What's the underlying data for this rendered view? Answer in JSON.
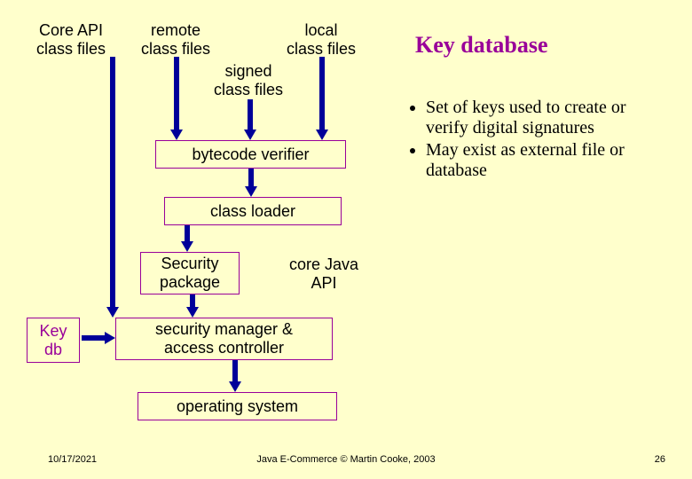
{
  "labels": {
    "core_api": "Core API\nclass files",
    "remote": "remote\nclass files",
    "local": "local\nclass files",
    "signed": "signed\nclass files",
    "key_db_left": "Key\ndb"
  },
  "boxes": {
    "bytecode_verifier": "bytecode verifier",
    "class_loader": "class loader",
    "security_package": "Security\npackage",
    "core_java_api": "core Java\nAPI",
    "sec_mgr": "security manager &\naccess controller",
    "os": "operating system"
  },
  "heading": "Key database",
  "bullets": [
    "Set of keys used to create or verify digital signatures",
    "May exist as external file or database"
  ],
  "footer": {
    "date": "10/17/2021",
    "credit": "Java E-Commerce © Martin Cooke, 2003",
    "page": "26"
  }
}
